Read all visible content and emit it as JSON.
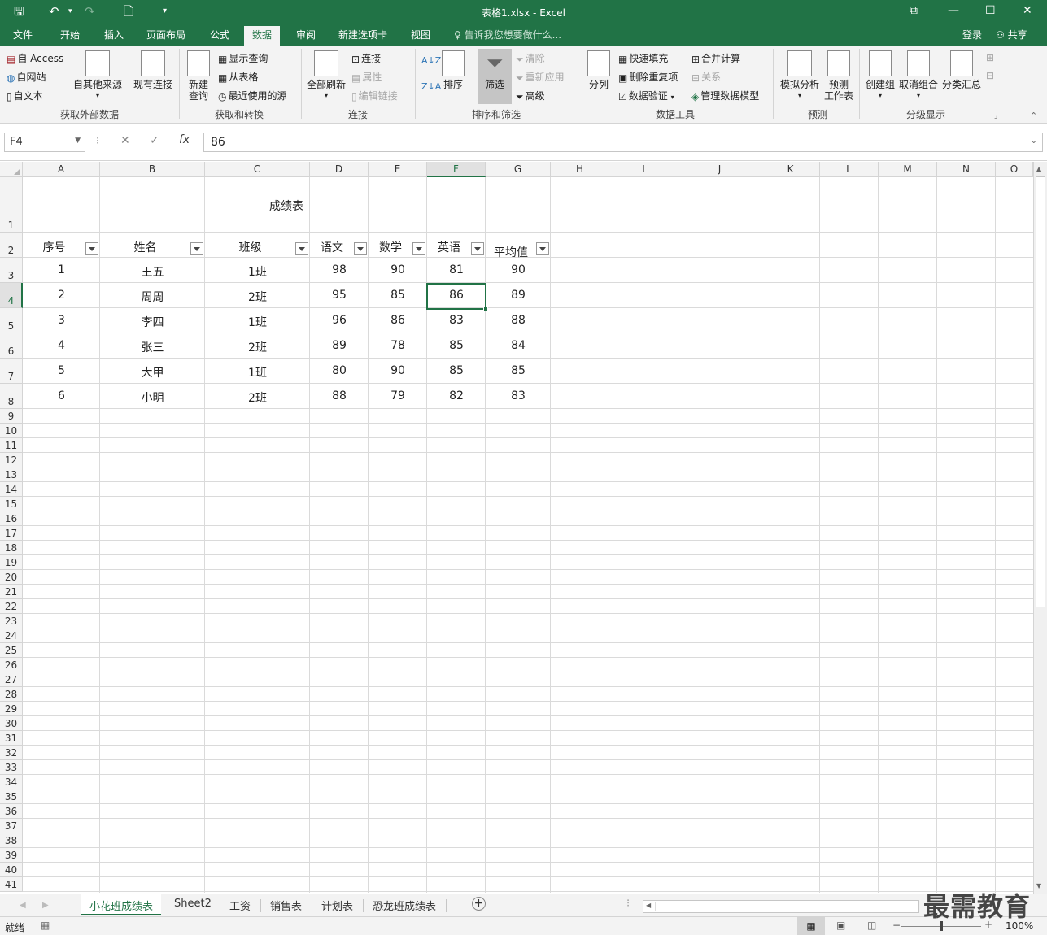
{
  "titlebar": {
    "title": "表格1.xlsx - Excel"
  },
  "tabs": [
    {
      "label": "文件"
    },
    {
      "label": "开始"
    },
    {
      "label": "插入"
    },
    {
      "label": "页面布局"
    },
    {
      "label": "公式"
    },
    {
      "label": "数据"
    },
    {
      "label": "审阅"
    },
    {
      "label": "新建选项卡"
    },
    {
      "label": "视图"
    }
  ],
  "tellme": "告诉我您想要做什么...",
  "account": {
    "login": "登录",
    "share": "共享"
  },
  "ribbon": {
    "get_external": {
      "access": "自 Access",
      "web": "自网站",
      "text": "自文本",
      "other": "自其他来源",
      "existing": "现有连接",
      "label": "获取外部数据"
    },
    "transform": {
      "new_query_1": "新建",
      "new_query_2": "查询",
      "show_queries": "显示查询",
      "from_table": "从表格",
      "recent_sources": "最近使用的源",
      "label": "获取和转换"
    },
    "connections": {
      "refresh_all": "全部刷新",
      "connections": "连接",
      "properties": "属性",
      "edit_links": "编辑链接",
      "label": "连接"
    },
    "sort_filter": {
      "sort": "排序",
      "filter": "筛选",
      "clear": "清除",
      "reapply": "重新应用",
      "advanced": "高级",
      "label": "排序和筛选"
    },
    "data_tools": {
      "text_to_columns": "分列",
      "flash_fill": "快速填充",
      "remove_dup": "删除重复项",
      "validation": "数据验证",
      "consolidate": "合并计算",
      "relationships": "关系",
      "manage_model": "管理数据模型",
      "label": "数据工具"
    },
    "forecast": {
      "what_if": "模拟分析",
      "sheet_1": "预测",
      "sheet_2": "工作表",
      "label": "预测"
    },
    "outline": {
      "group": "创建组",
      "ungroup": "取消组合",
      "subtotal": "分类汇总",
      "label": "分级显示"
    }
  },
  "formula_bar": {
    "name_box": "F4",
    "value": "86"
  },
  "columns": [
    "A",
    "B",
    "C",
    "D",
    "E",
    "F",
    "G",
    "H",
    "I",
    "J",
    "K",
    "L",
    "M",
    "N",
    "O"
  ],
  "rows": [
    "1",
    "2",
    "3",
    "4",
    "5",
    "6",
    "7",
    "8",
    "9",
    "10",
    "11",
    "12",
    "13",
    "14",
    "15",
    "16",
    "17",
    "18",
    "19",
    "20",
    "21",
    "22",
    "23",
    "24",
    "25",
    "26",
    "27",
    "28",
    "29",
    "30",
    "31",
    "32",
    "33",
    "34",
    "35",
    "36",
    "37",
    "38",
    "39",
    "40",
    "41"
  ],
  "sheet": {
    "title": "成绩表",
    "headers": [
      "序号",
      "姓名",
      "班级",
      "语文",
      "数学",
      "英语",
      "平均值"
    ],
    "data": [
      [
        "1",
        "王五",
        "1班",
        "98",
        "90",
        "81",
        "90"
      ],
      [
        "2",
        "周周",
        "2班",
        "95",
        "85",
        "86",
        "89"
      ],
      [
        "3",
        "李四",
        "1班",
        "96",
        "86",
        "83",
        "88"
      ],
      [
        "4",
        "张三",
        "2班",
        "89",
        "78",
        "85",
        "84"
      ],
      [
        "5",
        "大甲",
        "1班",
        "80",
        "90",
        "85",
        "85"
      ],
      [
        "6",
        "小明",
        "2班",
        "88",
        "79",
        "82",
        "83"
      ]
    ]
  },
  "sheet_tabs": [
    "小花班成绩表",
    "Sheet2",
    "工资",
    "销售表",
    "计划表",
    "恐龙班成绩表"
  ],
  "status": {
    "ready": "就绪",
    "zoom": "100%"
  },
  "watermark": "最需教育"
}
